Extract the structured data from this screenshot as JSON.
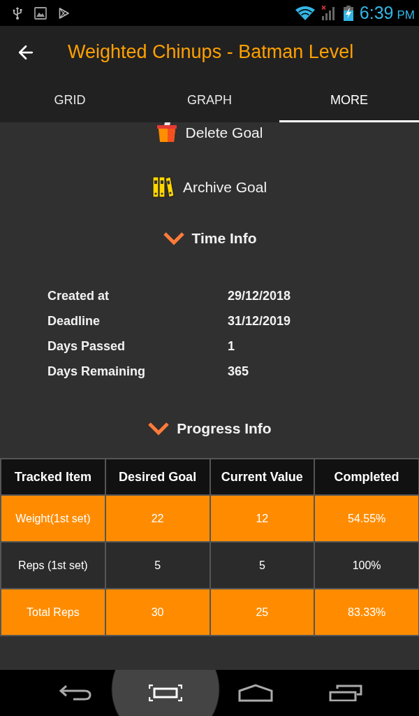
{
  "status_bar": {
    "time": "6:39",
    "period": "PM"
  },
  "app_bar": {
    "title": "Weighted Chinups - Batman Level"
  },
  "tabs": [
    {
      "label": "GRID",
      "selected": false
    },
    {
      "label": "GRAPH",
      "selected": false
    },
    {
      "label": "MORE",
      "selected": true
    }
  ],
  "actions": [
    {
      "kind": "delete",
      "label": "Delete Goal"
    },
    {
      "kind": "archive",
      "label": "Archive Goal"
    }
  ],
  "time_info": {
    "heading": "Time Info",
    "expanded": true,
    "rows": [
      {
        "label": "Created at",
        "value": "29/12/2018"
      },
      {
        "label": "Deadline",
        "value": "31/12/2019"
      },
      {
        "label": "Days Passed",
        "value": "1"
      },
      {
        "label": "Days Remaining",
        "value": "365"
      }
    ]
  },
  "progress_info": {
    "heading": "Progress Info",
    "expanded": true,
    "table": {
      "columns": [
        "Tracked Item",
        "Desired Goal",
        "Current Value",
        "Completed"
      ],
      "rows": [
        {
          "highlighted": true,
          "cells": [
            "Weight(1st set)",
            "22",
            "12",
            "54.55%"
          ]
        },
        {
          "highlighted": false,
          "cells": [
            "Reps (1st set)",
            "5",
            "5",
            "100%"
          ]
        },
        {
          "highlighted": true,
          "cells": [
            "Total Reps",
            "30",
            "25",
            "83.33%"
          ]
        }
      ]
    }
  }
}
